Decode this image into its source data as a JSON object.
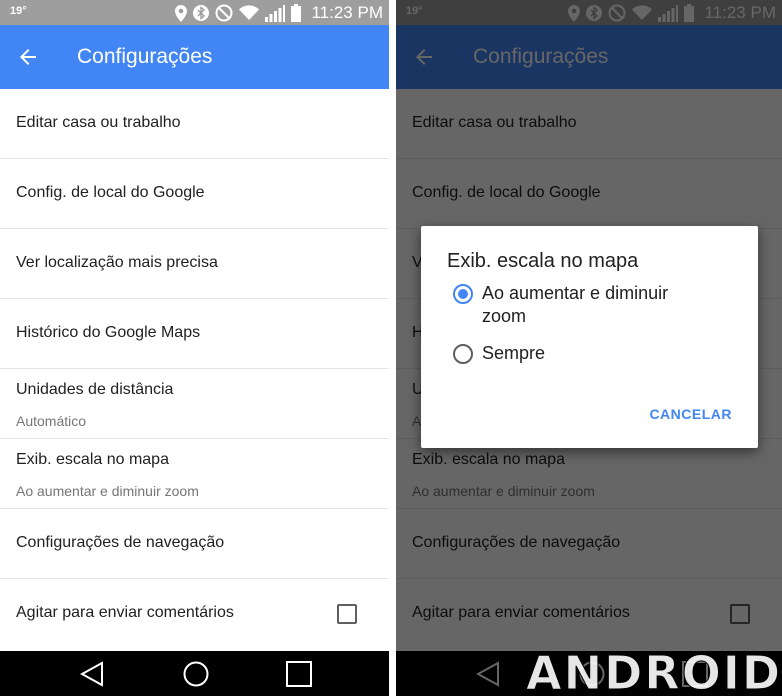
{
  "colors": {
    "appbar": "#4285f4",
    "accent": "#4285f4",
    "status_bar": "#9e9e9e"
  },
  "status_bar": {
    "temperature": "19°",
    "time": "11:23 PM",
    "icons": [
      "location-icon",
      "bluetooth-icon",
      "do-not-disturb-icon",
      "wifi-icon",
      "signal-icon",
      "battery-icon"
    ]
  },
  "app_bar": {
    "title": "Configurações",
    "back_icon": "arrow-left-icon"
  },
  "settings": {
    "edit_home_work": "Editar casa ou trabalho",
    "google_location": "Config. de local do Google",
    "precise_location": "Ver localização mais precisa",
    "maps_history": "Histórico do Google Maps",
    "distance_units": {
      "label": "Unidades de distância",
      "value": "Automático"
    },
    "map_scale": {
      "label": "Exib. escala no mapa",
      "value": "Ao aumentar e diminuir zoom"
    },
    "navigation": "Configurações de navegação",
    "shake_feedback": {
      "label": "Agitar para enviar comentários",
      "checked": false
    }
  },
  "dialog": {
    "title": "Exib. escala no mapa",
    "options": [
      {
        "label": "Ao aumentar e diminuir zoom",
        "selected": true
      },
      {
        "label": "Sempre",
        "selected": false
      }
    ],
    "cancel": "CANCELAR"
  },
  "watermark": "ANDROIDPIT"
}
